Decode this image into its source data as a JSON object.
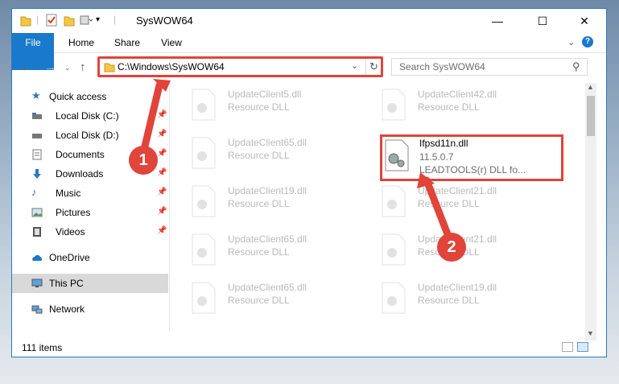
{
  "window": {
    "title": "SysWOW64"
  },
  "ribbon": {
    "tabs": [
      "File",
      "Home",
      "Share",
      "View"
    ]
  },
  "address": {
    "path": "C:\\Windows\\SysWOW64",
    "search_placeholder": "Search SysWOW64"
  },
  "nav": {
    "items": [
      {
        "label": "Quick access"
      },
      {
        "label": "Local Disk (C:)"
      },
      {
        "label": "Local Disk (D:)"
      },
      {
        "label": "Documents"
      },
      {
        "label": "Downloads"
      },
      {
        "label": "Music"
      },
      {
        "label": "Pictures"
      },
      {
        "label": "Videos"
      },
      {
        "label": "OneDrive"
      },
      {
        "label": "This PC"
      },
      {
        "label": "Network"
      }
    ]
  },
  "files": [
    {
      "name": "UpdateClient5.dll",
      "desc": "Resource DLL"
    },
    {
      "name": "UpdateClient42.dll",
      "desc": "Resource DLL"
    },
    {
      "name": "UpdateClient65.dll",
      "desc": "Resource DLL"
    },
    {
      "name": "Ifpsd11n.dll",
      "version": "11.5.0.7",
      "desc": "LEADTOOLS(r) DLL fo..."
    },
    {
      "name": "UpdateClient19.dll",
      "desc": "Resource DLL"
    },
    {
      "name": "UpdateClient21.dll",
      "desc": "Resource DLL"
    },
    {
      "name": "UpdateClient65.dll",
      "desc": "Resource DLL"
    },
    {
      "name": "UpdateClient21.dll",
      "desc": "Resource DLL"
    },
    {
      "name": "UpdateClient65.dll",
      "desc": "Resource DLL"
    },
    {
      "name": "UpdateClient19.dll",
      "desc": "Resource DLL"
    }
  ],
  "status": {
    "count": "111 items"
  },
  "callouts": {
    "one": "1",
    "two": "2"
  },
  "colors": {
    "accent": "#1979ca",
    "highlight": "#e0443a",
    "selected": "#d9d9d9"
  }
}
